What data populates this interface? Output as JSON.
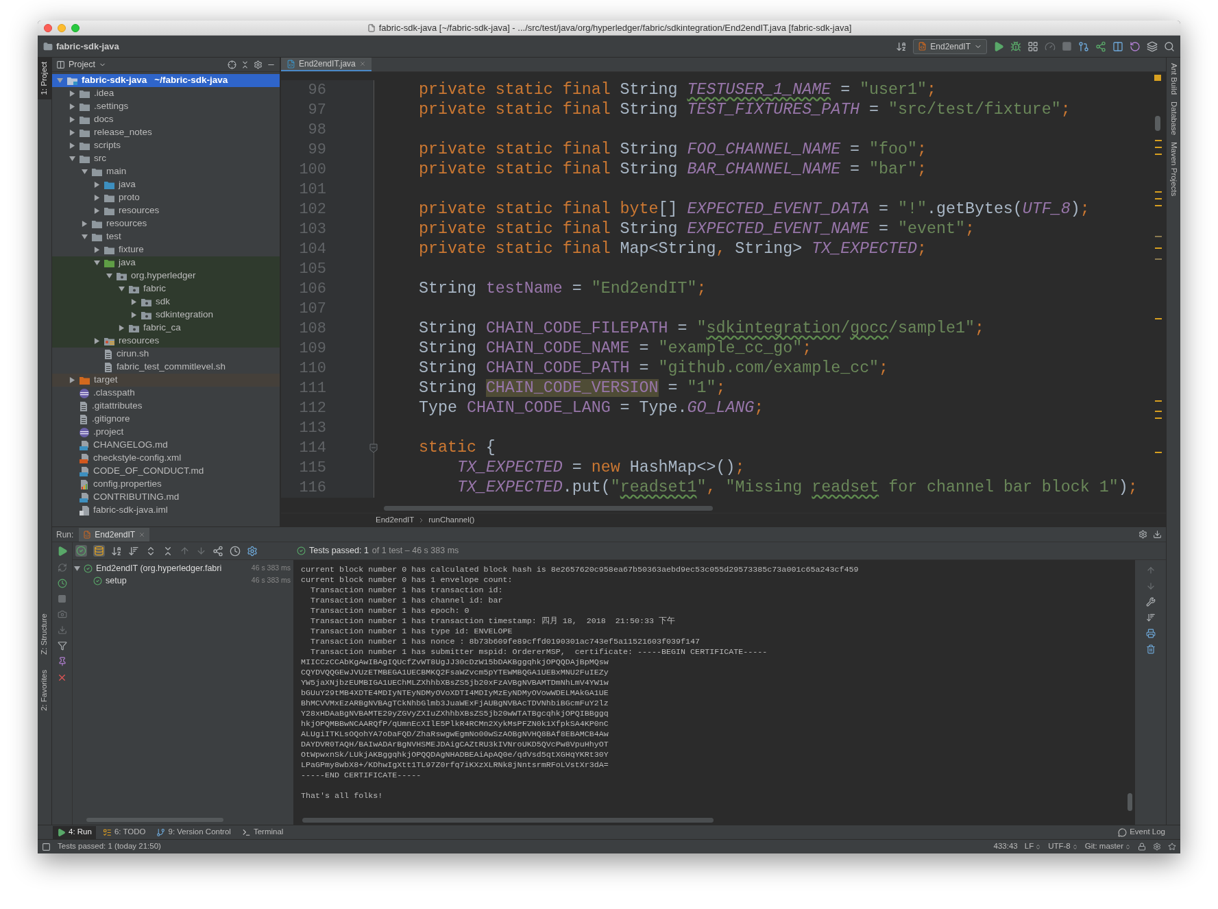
{
  "window": {
    "title": "fabric-sdk-java [~/fabric-sdk-java] - .../src/test/java/org/hyperledger/fabric/sdkintegration/End2endIT.java [fabric-sdk-java]"
  },
  "nav_bar": {
    "project": "fabric-sdk-java",
    "run_config": "End2endIT"
  },
  "left_tool_tabs": [
    {
      "label": "1: Project",
      "selected": true
    },
    {
      "label": "Z: Structure",
      "selected": false
    },
    {
      "label": "2: Favorites",
      "selected": false
    }
  ],
  "right_tool_tabs": [
    "Ant Build",
    "Database",
    "Maven Projects"
  ],
  "project_panel": {
    "title": "Project",
    "tree": [
      {
        "name": "fabric-sdk-java",
        "detail": "~/fabric-sdk-java",
        "kind": "module",
        "selected": true,
        "expanded": true,
        "children": [
          {
            "name": ".idea",
            "kind": "folder",
            "selected": false,
            "expanded": false
          },
          {
            "name": ".settings",
            "kind": "folder",
            "selected": false,
            "expanded": false
          },
          {
            "name": "docs",
            "kind": "folder",
            "selected": false,
            "expanded": false
          },
          {
            "name": "release_notes",
            "kind": "folder",
            "selected": false,
            "expanded": false
          },
          {
            "name": "scripts",
            "kind": "folder",
            "selected": false,
            "expanded": false
          },
          {
            "name": "src",
            "kind": "folder",
            "selected": false,
            "expanded": true,
            "children": [
              {
                "name": "main",
                "kind": "folder",
                "selected": false,
                "expanded": true,
                "children": [
                  {
                    "name": "java",
                    "kind": "source",
                    "selected": false,
                    "expanded": false
                  },
                  {
                    "name": "proto",
                    "kind": "folder",
                    "selected": false,
                    "expanded": false
                  },
                  {
                    "name": "resources",
                    "kind": "folder",
                    "selected": false,
                    "expanded": false
                  }
                ]
              },
              {
                "name": "resources",
                "kind": "folder",
                "selected": false,
                "expanded": false
              },
              {
                "name": "test",
                "kind": "folder",
                "selected": false,
                "expanded": true,
                "children": [
                  {
                    "name": "fixture",
                    "kind": "folder",
                    "selected": false,
                    "expanded": false
                  },
                  {
                    "name": "java",
                    "kind": "testsource",
                    "selected": false,
                    "expanded": true,
                    "children": [
                      {
                        "name": "org.hyperledger",
                        "kind": "package",
                        "selected": false,
                        "expanded": true,
                        "children": [
                          {
                            "name": "fabric",
                            "kind": "package",
                            "selected": false,
                            "expanded": true,
                            "children": [
                              {
                                "name": "sdk",
                                "kind": "package",
                                "selected": false,
                                "expanded": false
                              },
                              {
                                "name": "sdkintegration",
                                "kind": "package",
                                "selected": false,
                                "expanded": false
                              }
                            ]
                          },
                          {
                            "name": "fabric_ca",
                            "kind": "package",
                            "selected": false,
                            "expanded": false
                          }
                        ]
                      }
                    ]
                  },
                  {
                    "name": "resources",
                    "kind": "testresources",
                    "selected": false,
                    "expanded": false
                  },
                  {
                    "name": "cirun.sh",
                    "kind": "file",
                    "selected": false
                  },
                  {
                    "name": "fabric_test_commitlevel.sh",
                    "kind": "file",
                    "selected": false
                  }
                ]
              }
            ]
          },
          {
            "name": "target",
            "kind": "excluded",
            "selected": false,
            "expanded": false
          },
          {
            "name": ".classpath",
            "kind": "eclipse",
            "selected": false
          },
          {
            "name": ".gitattributes",
            "kind": "file",
            "selected": false
          },
          {
            "name": ".gitignore",
            "kind": "file",
            "selected": false
          },
          {
            "name": ".project",
            "kind": "eclipse",
            "selected": false
          },
          {
            "name": "CHANGELOG.md",
            "kind": "markdown",
            "selected": false
          },
          {
            "name": "checkstyle-config.xml",
            "kind": "xml",
            "selected": false
          },
          {
            "name": "CODE_OF_CONDUCT.md",
            "kind": "markdown",
            "selected": false
          },
          {
            "name": "config.properties",
            "kind": "properties",
            "selected": false
          },
          {
            "name": "CONTRIBUTING.md",
            "kind": "markdown",
            "selected": false
          },
          {
            "name": "fabric-sdk-java.iml",
            "kind": "iml",
            "selected": false
          }
        ]
      }
    ]
  },
  "editor": {
    "tabs": [
      {
        "label": "End2endIT.java",
        "selected": true
      }
    ],
    "lines": [
      {
        "number": "96",
        "tokens": [
          {
            "text": "private static final",
            "kind": "keyword"
          },
          {
            "text": " String ",
            "kind": "plain"
          },
          {
            "text": "TESTUSER_1_NAME",
            "kind": "typoconst"
          },
          {
            "text": " = ",
            "kind": "plain"
          },
          {
            "text": "\"user1\"",
            "kind": "string"
          },
          {
            "text": ";",
            "kind": "keyword"
          }
        ]
      },
      {
        "number": "97",
        "tokens": [
          {
            "text": "private static final",
            "kind": "keyword"
          },
          {
            "text": " String ",
            "kind": "plain"
          },
          {
            "text": "TEST_FIXTURES_PATH",
            "kind": "constant"
          },
          {
            "text": " = ",
            "kind": "plain"
          },
          {
            "text": "\"src/test/fixture\"",
            "kind": "string"
          },
          {
            "text": ";",
            "kind": "keyword"
          }
        ]
      },
      {
        "number": "98"
      },
      {
        "number": "99",
        "tokens": [
          {
            "text": "private static final",
            "kind": "keyword"
          },
          {
            "text": " String ",
            "kind": "plain"
          },
          {
            "text": "FOO_CHANNEL_NAME",
            "kind": "constant"
          },
          {
            "text": " = ",
            "kind": "plain"
          },
          {
            "text": "\"foo\"",
            "kind": "string"
          },
          {
            "text": ";",
            "kind": "keyword"
          }
        ]
      },
      {
        "number": "100",
        "tokens": [
          {
            "text": "private static final",
            "kind": "keyword"
          },
          {
            "text": " String ",
            "kind": "plain"
          },
          {
            "text": "BAR_CHANNEL_NAME",
            "kind": "constant"
          },
          {
            "text": " = ",
            "kind": "plain"
          },
          {
            "text": "\"bar\"",
            "kind": "string"
          },
          {
            "text": ";",
            "kind": "keyword"
          }
        ]
      },
      {
        "number": "101"
      },
      {
        "number": "102",
        "tokens": [
          {
            "text": "private static final byte",
            "kind": "keyword"
          },
          {
            "text": "[] ",
            "kind": "plain"
          },
          {
            "text": "EXPECTED_EVENT_DATA",
            "kind": "constant"
          },
          {
            "text": " = ",
            "kind": "plain"
          },
          {
            "text": "\"!\"",
            "kind": "string"
          },
          {
            "text": ".getBytes(",
            "kind": "plain"
          },
          {
            "text": "UTF_8",
            "kind": "constant"
          },
          {
            "text": ")",
            "kind": "plain"
          },
          {
            "text": ";",
            "kind": "keyword"
          }
        ]
      },
      {
        "number": "103",
        "tokens": [
          {
            "text": "private static final",
            "kind": "keyword"
          },
          {
            "text": " String ",
            "kind": "plain"
          },
          {
            "text": "EXPECTED_EVENT_NAME",
            "kind": "constant"
          },
          {
            "text": " = ",
            "kind": "plain"
          },
          {
            "text": "\"event\"",
            "kind": "string"
          },
          {
            "text": ";",
            "kind": "keyword"
          }
        ]
      },
      {
        "number": "104",
        "tokens": [
          {
            "text": "private static final",
            "kind": "keyword"
          },
          {
            "text": " Map<String",
            "kind": "plain"
          },
          {
            "text": ",",
            "kind": "keyword"
          },
          {
            "text": " String> ",
            "kind": "plain"
          },
          {
            "text": "TX_EXPECTED",
            "kind": "constant"
          },
          {
            "text": ";",
            "kind": "keyword"
          }
        ]
      },
      {
        "number": "105"
      },
      {
        "number": "106",
        "tokens": [
          {
            "text": "String ",
            "kind": "plain"
          },
          {
            "text": "testName",
            "kind": "field"
          },
          {
            "text": " = ",
            "kind": "plain"
          },
          {
            "text": "\"End2endIT\"",
            "kind": "string"
          },
          {
            "text": ";",
            "kind": "keyword"
          }
        ]
      },
      {
        "number": "107"
      },
      {
        "number": "108",
        "tokens": [
          {
            "text": "String ",
            "kind": "plain"
          },
          {
            "text": "CHAIN_CODE_FILEPATH",
            "kind": "field"
          },
          {
            "text": " = ",
            "kind": "plain"
          },
          {
            "text": "\"",
            "kind": "string"
          },
          {
            "text": "sdkintegration",
            "kind": "typo"
          },
          {
            "text": "/",
            "kind": "string"
          },
          {
            "text": "gocc",
            "kind": "typo"
          },
          {
            "text": "/sample1\"",
            "kind": "string"
          },
          {
            "text": ";",
            "kind": "keyword"
          }
        ]
      },
      {
        "number": "109",
        "tokens": [
          {
            "text": "String ",
            "kind": "plain"
          },
          {
            "text": "CHAIN_CODE_NAME",
            "kind": "field"
          },
          {
            "text": " = ",
            "kind": "plain"
          },
          {
            "text": "\"example_cc_go\"",
            "kind": "string"
          },
          {
            "text": ";",
            "kind": "keyword"
          }
        ]
      },
      {
        "number": "110",
        "tokens": [
          {
            "text": "String ",
            "kind": "plain"
          },
          {
            "text": "CHAIN_CODE_PATH",
            "kind": "field"
          },
          {
            "text": " = ",
            "kind": "plain"
          },
          {
            "text": "\"github.com/example_cc\"",
            "kind": "string"
          },
          {
            "text": ";",
            "kind": "keyword"
          }
        ]
      },
      {
        "number": "111",
        "tokens": [
          {
            "text": "String ",
            "kind": "plain"
          },
          {
            "text": "CHAIN_CODE_VERSION",
            "kind": "marked"
          },
          {
            "text": " = ",
            "kind": "plain"
          },
          {
            "text": "\"1\"",
            "kind": "string"
          },
          {
            "text": ";",
            "kind": "keyword"
          }
        ]
      },
      {
        "number": "112",
        "tokens": [
          {
            "text": "Type ",
            "kind": "plain"
          },
          {
            "text": "CHAIN_CODE_LANG",
            "kind": "field"
          },
          {
            "text": " = Type.",
            "kind": "plain"
          },
          {
            "text": "GO_LANG",
            "kind": "constant"
          },
          {
            "text": ";",
            "kind": "keyword"
          }
        ]
      },
      {
        "number": "113"
      },
      {
        "number": "114",
        "tokens": [
          {
            "text": "static",
            "kind": "keyword"
          },
          {
            "text": " {",
            "kind": "plain"
          }
        ],
        "children": [
          {
            "number": "115",
            "tokens": [
              {
                "text": "TX_EXPECTED",
                "kind": "constant"
              },
              {
                "text": " = ",
                "kind": "plain"
              },
              {
                "text": "new",
                "kind": "keyword"
              },
              {
                "text": " HashMap<>()",
                "kind": "plain"
              },
              {
                "text": ";",
                "kind": "keyword"
              }
            ]
          },
          {
            "number": "116",
            "tokens": [
              {
                "text": "TX_EXPECTED",
                "kind": "constant"
              },
              {
                "text": ".put(",
                "kind": "plain"
              },
              {
                "text": "\"",
                "kind": "string"
              },
              {
                "text": "readset1",
                "kind": "typo"
              },
              {
                "text": "\"",
                "kind": "string"
              },
              {
                "text": ",",
                "kind": "keyword"
              },
              {
                "text": " \"Missing ",
                "kind": "string"
              },
              {
                "text": "readset",
                "kind": "typo"
              },
              {
                "text": " for channel bar block 1\"",
                "kind": "string"
              },
              {
                "text": ")",
                "kind": "plain"
              },
              {
                "text": ";",
                "kind": "keyword"
              }
            ]
          }
        ]
      }
    ],
    "breadcrumbs": [
      "End2endIT",
      "runChannel()"
    ]
  },
  "run_panel": {
    "label": "Run:",
    "tabs": [
      {
        "label": "End2endIT",
        "selected": true
      }
    ],
    "summary": {
      "status": "Tests passed: 1",
      "detail": "of 1 test – 46 s 383 ms"
    },
    "tests": [
      {
        "name": "End2endIT (org.hyperledger.fabri",
        "time": "46 s 383 ms",
        "passed": true,
        "expanded": true,
        "children": [
          {
            "name": "setup",
            "time": "46 s 383 ms",
            "passed": true
          }
        ]
      }
    ],
    "console": {
      "lines": [
        "current block number 0 has calculated block hash is 8e2657620c958ea67b50363aebd9ec53c055d29573385c73a001c65a243cf459",
        "current block number 0 has 1 envelope count:",
        "  Transaction number 1 has transaction id:",
        "  Transaction number 1 has channel id: bar",
        "  Transaction number 1 has epoch: 0",
        "  Transaction number 1 has transaction timestamp: 四月 18,  2018  21:50:33 下午",
        "  Transaction number 1 has type id: ENVELOPE",
        "  Transaction number 1 has nonce : 8b73b609fe89cffd0190301ac743ef5a11521603f039f147",
        "  Transaction number 1 has submitter mspid: OrdererMSP,  certificate: -----BEGIN CERTIFICATE-----",
        "MIICCzCCAbKgAwIBAgIQUcfZvWT8UgJJ30cDzW15bDAKBggqhkjOPQQDAjBpMQsw",
        "CQYDVQQGEwJVUzETMBEGA1UECBMKQ2FsaWZvcm5pYTEWMBQGA1UEBxMNU2FuIEZy",
        "YW5jaXNjbzEUMBIGA1UEChMLZXhhbXBsZS5jb20xFzAVBgNVBAMTDmNhLmV4YW1w",
        "bGUuY29tMB4XDTE4MDIyNTEyNDMyOVoXDTI4MDIyMzEyNDMyOVowWDELMAkGA1UE",
        "BhMCVVMxEzARBgNVBAgTCkNhbGlmb3JuaWExFjAUBgNVBAcTDVNhbiBGcmFuY2lz",
        "Y28xHDAaBgNVBAMTE29yZGVyZXIuZXhhbXBsZS5jb20wWTATBgcqhkjOPQIBBggq",
        "hkjOPQMBBwNCAARQfP/qUmnEcXIlE5PlkR4RCMn2XykMsPFZN0k1XfpkSA4KP0nC",
        "ALUgiITKLsOQohYA7oDaFQD/ZhaRswgwEgmNo00wSzAOBgNVHQ8BAf8EBAMCB4Aw",
        "DAYDVR0TAQH/BAIwADArBgNVHSMEJDAigCAZtRU3kIVNroUKD5QVcPw8VpuHhyOT",
        "OtWpwxnSk/LUkjAKBggqhkjOPQQDAgNHADBEAiApAQ0e/qdVsd5qtXGHqYKRt30Y",
        "LPaGPmy8wbX8+/KDhwIgXtt1TL97Z0rfq7iKXzXLRNk8jNntsrmRFoLVstXr3dA=",
        "-----END CERTIFICATE-----"
      ],
      "footer": "That's all folks!"
    }
  },
  "tool_window_bar": {
    "tabs": [
      {
        "label": "4: Run",
        "kind": "run",
        "selected": true
      },
      {
        "label": "6: TODO",
        "kind": "todo",
        "selected": false
      },
      {
        "label": "9: Version Control",
        "kind": "vcs",
        "selected": false
      },
      {
        "label": "Terminal",
        "kind": "terminal",
        "selected": false
      }
    ],
    "event_log": "Event Log"
  },
  "status_bar": {
    "message": "Tests passed: 1 (today 21:50)",
    "position": "433:43",
    "line_separator": "LF",
    "encoding": "UTF-8",
    "vcs": "Git: master"
  }
}
